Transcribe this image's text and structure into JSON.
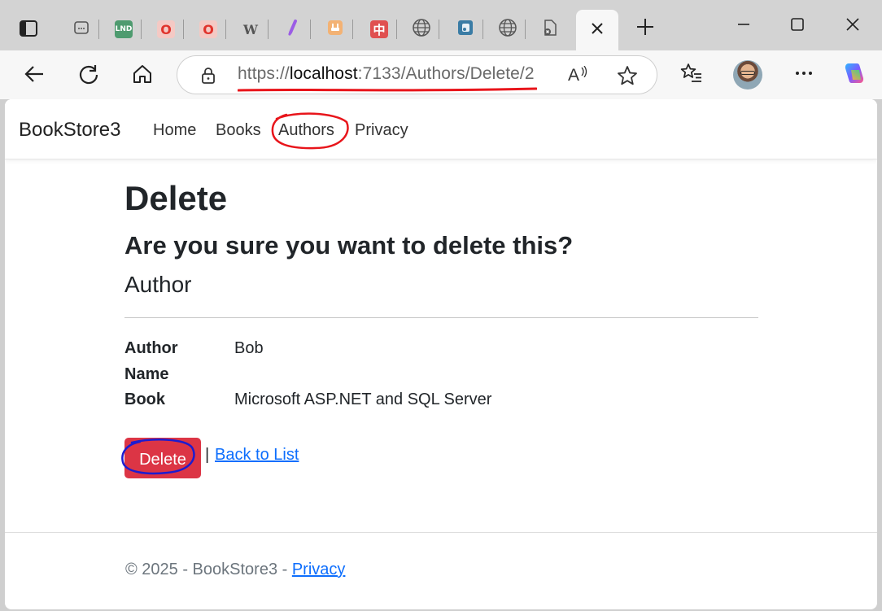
{
  "browser": {
    "tabs": [
      {
        "icon": "page-icon"
      },
      {
        "icon": "lnd-icon",
        "label": "LND",
        "color": "#4e9b6f"
      },
      {
        "icon": "opera-o-icon",
        "label": "O",
        "color": "#e0342c"
      },
      {
        "icon": "opera-o-icon",
        "label": "O",
        "color": "#e0342c"
      },
      {
        "icon": "w-logo-icon",
        "label": "W"
      },
      {
        "icon": "slash-icon",
        "color": "#9b5de5"
      },
      {
        "icon": "plug-icon",
        "color": "#f0a050"
      },
      {
        "icon": "chinese-char-icon",
        "label": "中",
        "color": "#e05050"
      },
      {
        "icon": "globe-icon"
      },
      {
        "icon": "blue-app-icon",
        "color": "#3a7ca5"
      },
      {
        "icon": "globe-icon"
      },
      {
        "icon": "broken-page-icon"
      }
    ],
    "new_tab_label": "+",
    "url_prefix": "https://",
    "url_host": "localhost",
    "url_path": ":7133/Authors/Delete/2",
    "read_aloud_glyph": "A"
  },
  "site": {
    "brand": "BookStore3",
    "nav": [
      {
        "label": "Home"
      },
      {
        "label": "Books"
      },
      {
        "label": "Authors"
      },
      {
        "label": "Privacy"
      }
    ]
  },
  "page": {
    "title": "Delete",
    "question": "Are you sure you want to delete this?",
    "entity": "Author",
    "fields": [
      {
        "label": "Author Name",
        "value": "Bob"
      },
      {
        "label": "Book",
        "value": "Microsoft ASP.NET and SQL Server"
      }
    ],
    "delete_label": "Delete",
    "separator": "|",
    "back_label": "Back to List"
  },
  "footer": {
    "text": "© 2025 - BookStore3 - ",
    "link": "Privacy"
  },
  "colors": {
    "delete_button": "#dc3545",
    "link": "#0d6efd",
    "annotation_red": "#e8151b",
    "annotation_blue": "#1c1ccf"
  }
}
